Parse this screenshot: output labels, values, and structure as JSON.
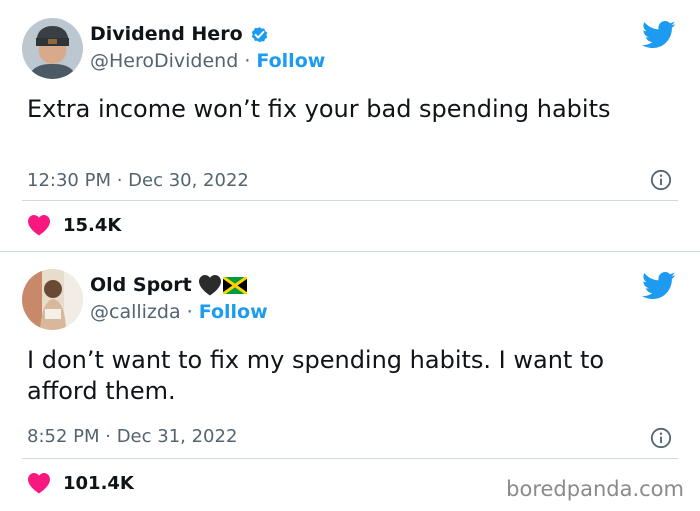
{
  "tweets": [
    {
      "display_name": "Dividend Hero",
      "handle": "@HeroDividend",
      "separator": " · ",
      "follow_label": "Follow",
      "text": "Extra income won’t fix your bad spending habits",
      "timestamp": "12:30 PM · Dec 30, 2022",
      "likes": "15.4K",
      "verified": true
    },
    {
      "display_name": "Old Sport",
      "handle": "@callizda",
      "separator": " · ",
      "follow_label": "Follow",
      "text": "I don’t want to fix my spending habits. I want to afford them.",
      "timestamp": "8:52 PM · Dec 31, 2022",
      "likes": "101.4K",
      "name_emojis": [
        "black-heart-icon",
        "jamaica-flag-icon"
      ]
    }
  ],
  "watermark": "boredpanda.com",
  "colors": {
    "twitter_blue": "#1d9bf0",
    "like_pink": "#f91880",
    "secondary_text": "#536471",
    "divider": "#cfd9de"
  }
}
